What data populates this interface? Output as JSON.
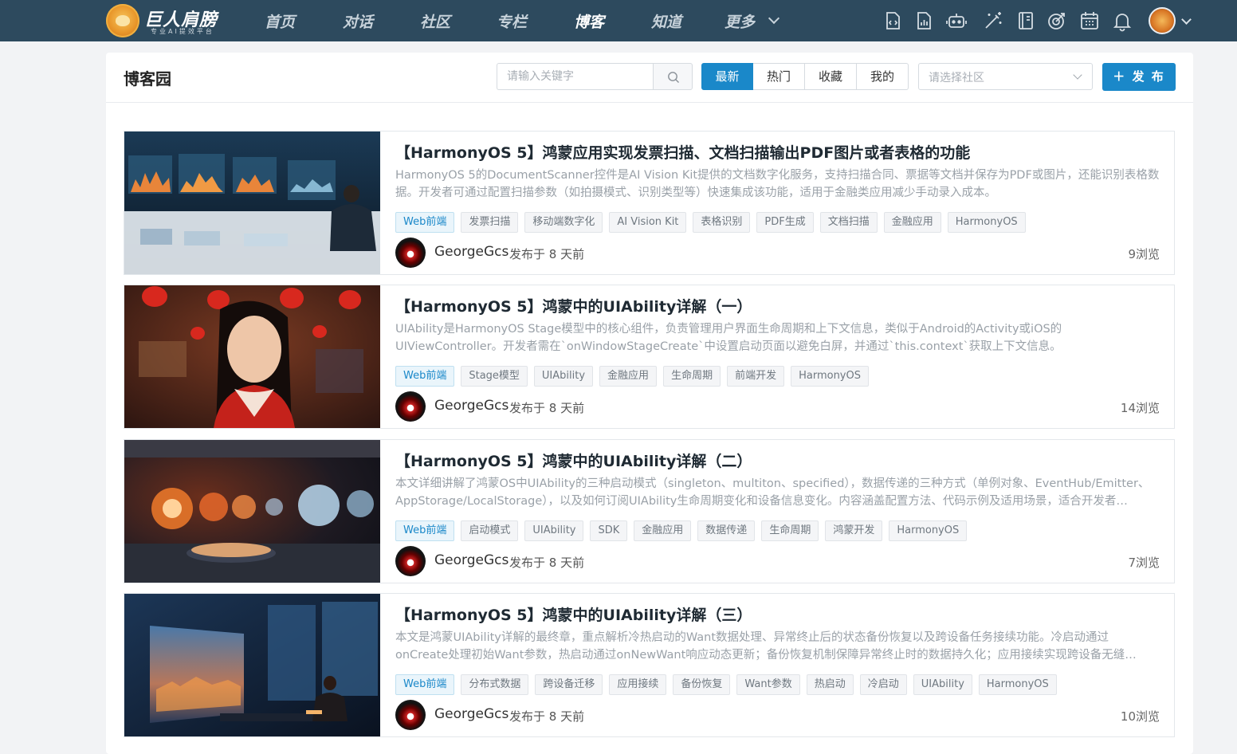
{
  "brand": {
    "name": "巨人肩膀",
    "slogan": "专业AI提效平台"
  },
  "nav": {
    "items": [
      {
        "label": "首页"
      },
      {
        "label": "对话"
      },
      {
        "label": "社区"
      },
      {
        "label": "专栏"
      },
      {
        "label": "博客",
        "active": true
      },
      {
        "label": "知道"
      },
      {
        "label": "更多"
      }
    ],
    "icons": [
      "code-file-icon",
      "chart-file-icon",
      "robot-icon",
      "magic-wand-icon",
      "notebook-icon",
      "target-icon",
      "calendar-icon",
      "bell-icon"
    ]
  },
  "page": {
    "title": "博客园",
    "search_placeholder": "请输入关键字",
    "filters": [
      "最新",
      "热门",
      "收藏",
      "我的"
    ],
    "active_filter": "最新",
    "community_placeholder": "请选择社区",
    "publish_label": "＋ 发 布"
  },
  "colors": {
    "nav_bg": "#2d4a5e",
    "accent": "#1a88c9"
  },
  "articles": [
    {
      "title": "【HarmonyOS 5】鸿蒙应用实现发票扫描、文档扫描输出PDF图片或者表格的功能",
      "desc": "HarmonyOS 5的DocumentScanner控件是AI Vision Kit提供的文档数字化服务，支持扫描合同、票据等文档并保存为PDF或图片，还能识别表格数据。开发者可通过配置扫描参数（如拍摄模式、识别类型等）快速集成该功能，适用于金融类应用减少手动录入成本。",
      "tags": [
        "Web前端",
        "发票扫描",
        "移动端数字化",
        "AI Vision Kit",
        "表格识别",
        "PDF生成",
        "文档扫描",
        "金融应用",
        "HarmonyOS"
      ],
      "author": "GeorgeGcs",
      "time": "发布于 8 天前",
      "views": "9浏览"
    },
    {
      "title": "【HarmonyOS 5】鸿蒙中的UIAbility详解（一）",
      "desc": "UIAbility是HarmonyOS Stage模型中的核心组件，负责管理用户界面生命周期和上下文信息，类似于Android的Activity或iOS的UIViewController。开发者需在`onWindowStageCreate`中设置启动页面以避免白屏，并通过`this.context`获取上下文信息。",
      "tags": [
        "Web前端",
        "Stage模型",
        "UIAbility",
        "金融应用",
        "生命周期",
        "前端开发",
        "HarmonyOS"
      ],
      "author": "GeorgeGcs",
      "time": "发布于 8 天前",
      "views": "14浏览"
    },
    {
      "title": "【HarmonyOS 5】鸿蒙中的UIAbility详解（二）",
      "desc": "本文详细讲解了鸿蒙OS中UIAbility的三种启动模式（singleton、multiton、specified），数据传递的三种方式（单例对象、EventHub/Emitter、AppStorage/LocalStorage），以及如何订阅UIAbility生命周期变化和设备信息变化。内容涵盖配置方法、代码示例及适用场景，适合开发者…",
      "tags": [
        "Web前端",
        "启动模式",
        "UIAbility",
        "SDK",
        "金融应用",
        "数据传递",
        "生命周期",
        "鸿蒙开发",
        "HarmonyOS"
      ],
      "author": "GeorgeGcs",
      "time": "发布于 8 天前",
      "views": "7浏览"
    },
    {
      "title": "【HarmonyOS 5】鸿蒙中的UIAbility详解（三）",
      "desc": "本文是鸿蒙UIAbility详解的最终章，重点解析冷热启动的Want数据处理、异常终止后的状态备份恢复以及跨设备任务接续功能。冷启动通过onCreate处理初始Want参数，热启动通过onNewWant响应动态更新；备份恢复机制保障异常终止时的数据持久化；应用接续实现跨设备无缝…",
      "tags": [
        "Web前端",
        "分布式数据",
        "跨设备迁移",
        "应用接续",
        "备份恢复",
        "Want参数",
        "热启动",
        "冷启动",
        "UIAbility",
        "HarmonyOS"
      ],
      "author": "GeorgeGcs",
      "time": "发布于 8 天前",
      "views": "10浏览"
    }
  ]
}
